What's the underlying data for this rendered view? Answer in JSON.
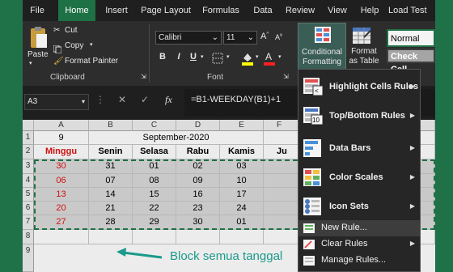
{
  "tabs": [
    "File",
    "Home",
    "Insert",
    "Page Layout",
    "Formulas",
    "Data",
    "Review",
    "View",
    "Help",
    "Load Test"
  ],
  "clipboard": {
    "paste": "Paste",
    "cut": "Cut",
    "copy": "Copy",
    "format_painter": "Format Painter",
    "group": "Clipboard"
  },
  "font": {
    "name": "Calibri",
    "size": "11",
    "group": "Font",
    "bold": "B",
    "italic": "I",
    "underline": "U"
  },
  "styles": {
    "conditional_formatting": "Conditional Formatting",
    "format_as_table": "Format as Table",
    "normal": "Normal",
    "check_cell": "Check Cell"
  },
  "formula_bar": {
    "name_box": "A3",
    "fx": "fx",
    "formula": "=B1-WEEKDAY(B1)+1"
  },
  "grid": {
    "columns": [
      "A",
      "B",
      "C",
      "D",
      "E",
      "F"
    ],
    "rows": [
      "1",
      "2",
      "3",
      "4",
      "5",
      "6",
      "7",
      "8",
      "9"
    ],
    "a1": "9",
    "title": "September-2020",
    "days": [
      "Minggu",
      "Senin",
      "Selasa",
      "Rabu",
      "Kamis",
      "Ju"
    ],
    "data": [
      [
        "30",
        "31",
        "01",
        "02",
        "03"
      ],
      [
        "06",
        "07",
        "08",
        "09",
        "10"
      ],
      [
        "13",
        "14",
        "15",
        "16",
        "17"
      ],
      [
        "20",
        "21",
        "22",
        "23",
        "24"
      ],
      [
        "27",
        "28",
        "29",
        "30",
        "01"
      ]
    ]
  },
  "annotation": "Block semua tanggal",
  "menu": {
    "items": [
      "Highlight Cells Rules",
      "Top/Bottom Rules",
      "Data Bars",
      "Color Scales",
      "Icon Sets",
      "New Rule...",
      "Clear Rules",
      "Manage Rules..."
    ]
  },
  "colors": {
    "excel_green": "#1e7145",
    "accent_annotation": "#1a9a8a",
    "sunday_red": "#d01010"
  }
}
